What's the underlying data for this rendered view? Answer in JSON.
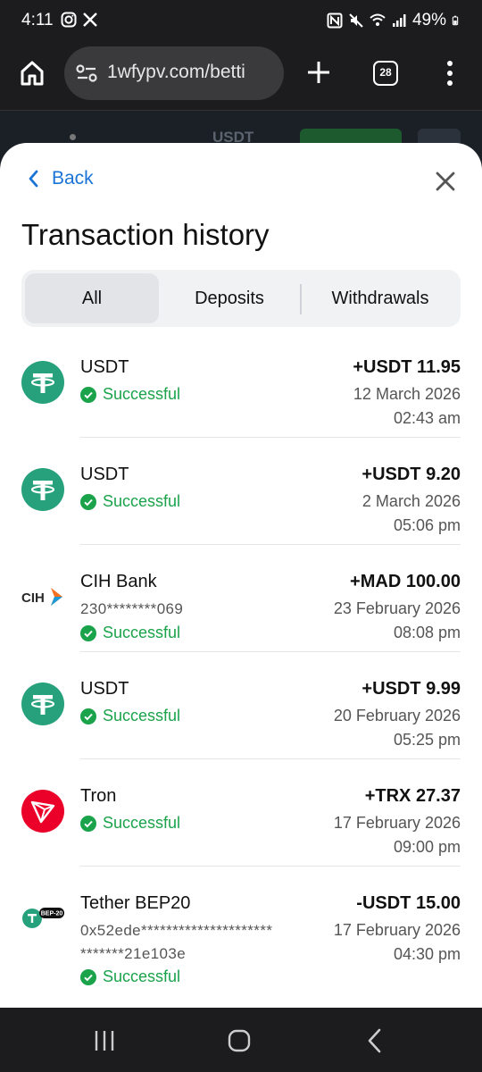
{
  "status_bar": {
    "time": "4:11",
    "battery": "49%"
  },
  "browser": {
    "url": "1wfypv.com/betti",
    "tab_count": "28"
  },
  "peek": {
    "currency": "USDT"
  },
  "sheet": {
    "back_label": "Back",
    "title": "Transaction history",
    "tabs": [
      {
        "label": "All",
        "active": true
      },
      {
        "label": "Deposits",
        "active": false
      },
      {
        "label": "Withdrawals",
        "active": false
      }
    ]
  },
  "transactions": [
    {
      "icon": "tether-icon",
      "name": "USDT",
      "sub": "",
      "status": "Successful",
      "amount": "+USDT 11.95",
      "date": "12 March 2026",
      "time": "02:43 am"
    },
    {
      "icon": "tether-icon",
      "name": "USDT",
      "sub": "",
      "status": "Successful",
      "amount": "+USDT 9.20",
      "date": "2 March 2026",
      "time": "05:06 pm"
    },
    {
      "icon": "cih-bank-icon",
      "name": "CIH Bank",
      "sub": "230********069",
      "status": "Successful",
      "amount": "+MAD 100.00",
      "date": "23 February 2026",
      "time": "08:08 pm"
    },
    {
      "icon": "tether-icon",
      "name": "USDT",
      "sub": "",
      "status": "Successful",
      "amount": "+USDT 9.99",
      "date": "20 February 2026",
      "time": "05:25 pm"
    },
    {
      "icon": "tron-icon",
      "name": "Tron",
      "sub": "",
      "status": "Successful",
      "amount": "+TRX 27.37",
      "date": "17 February 2026",
      "time": "09:00 pm"
    },
    {
      "icon": "tether-bep20-icon",
      "name": "Tether BEP20",
      "sub": "0x52ede*********************",
      "sub2": "*******21e103e",
      "status": "Successful",
      "amount": "-USDT 15.00",
      "date": "17 February 2026",
      "time": "04:30 pm",
      "badge": "BEP-20"
    }
  ],
  "colors": {
    "accent": "#1a73d6",
    "success": "#1aa34a",
    "tether": "#26a17b",
    "tron": "#eb0029"
  }
}
